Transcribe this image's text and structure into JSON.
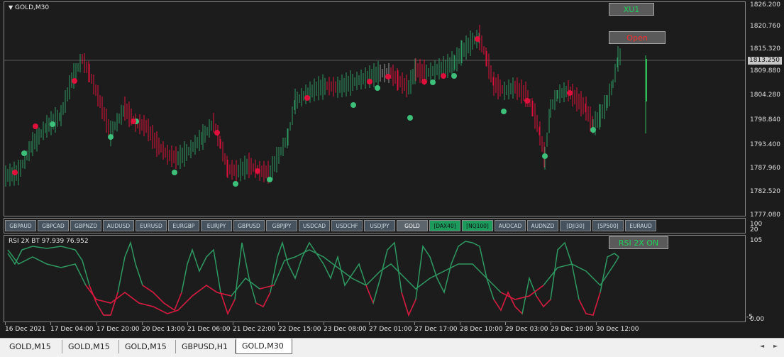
{
  "window": {
    "title": "GOLD,M30"
  },
  "price_axis": {
    "ticks": [
      "1826.200",
      "1820.760",
      "1815.320",
      "1809.880",
      "1804.280",
      "1798.840",
      "1793.400",
      "1787.960",
      "1782.520",
      "1777.080"
    ],
    "current_price": "1813.250"
  },
  "rsi_axis": {
    "ticks": [
      "105",
      "100",
      "20",
      "0.00",
      "-5"
    ],
    "label": "RSI 2X BT 97.939 76.952"
  },
  "time_axis": {
    "labels": [
      "16 Dec 2021",
      "17 Dec 04:00",
      "17 Dec 20:00",
      "20 Dec 13:00",
      "21 Dec 06:00",
      "21 Dec 22:00",
      "22 Dec 15:00",
      "23 Dec 08:00",
      "27 Dec 01:00",
      "27 Dec 17:00",
      "28 Dec 10:00",
      "29 Dec 03:00",
      "29 Dec 19:00",
      "30 Dec 12:00"
    ]
  },
  "buttons": {
    "xu1": {
      "label": "XU1",
      "color": "#1fd25a"
    },
    "open": {
      "label": "Open",
      "color": "#ff2a2a"
    },
    "rsi": {
      "label": "RSI 2X ON",
      "color": "#1fd25a"
    }
  },
  "symbols": [
    {
      "label": "GBPAUD",
      "style": "normal"
    },
    {
      "label": "GBPCAD",
      "style": "normal"
    },
    {
      "label": "GBPNZD",
      "style": "normal"
    },
    {
      "label": "AUDUSD",
      "style": "normal"
    },
    {
      "label": "EURUSD",
      "style": "normal"
    },
    {
      "label": "EURGBP",
      "style": "normal"
    },
    {
      "label": "EURJPY",
      "style": "normal"
    },
    {
      "label": "GBPUSD",
      "style": "normal"
    },
    {
      "label": "GBPJPY",
      "style": "normal"
    },
    {
      "label": "USDCAD",
      "style": "normal"
    },
    {
      "label": "USDCHF",
      "style": "normal"
    },
    {
      "label": "USDJPY",
      "style": "normal"
    },
    {
      "label": "GOLD",
      "style": "gray"
    },
    {
      "label": "[DAX40]",
      "style": "green"
    },
    {
      "label": "[NQ100]",
      "style": "green"
    },
    {
      "label": "AUDCAD",
      "style": "normal"
    },
    {
      "label": "AUDNZD",
      "style": "normal"
    },
    {
      "label": "[DJI30]",
      "style": "normal"
    },
    {
      "label": "[SP500]",
      "style": "normal"
    },
    {
      "label": "EURAUD",
      "style": "normal"
    }
  ],
  "tabs": [
    {
      "label": "GOLD,M15"
    },
    {
      "label": "GOLD,M15"
    },
    {
      "label": "GOLD,M15"
    },
    {
      "label": "GBPUSD,H1"
    },
    {
      "label": "GOLD,M30"
    }
  ],
  "colors": {
    "bull": "#2e9a62",
    "bear": "#e0103c",
    "neutral": "#9a9a9a",
    "dot_green": "#3cc07a",
    "dot_red": "#e0103c"
  }
}
